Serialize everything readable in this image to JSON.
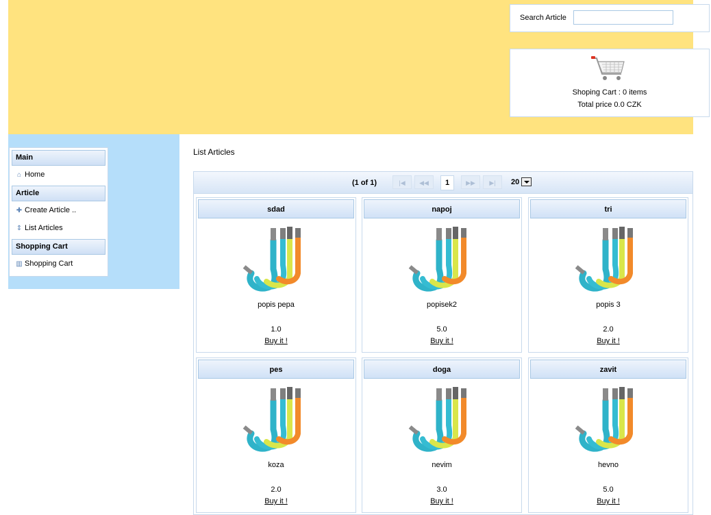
{
  "search": {
    "label": "Search Article",
    "value": ""
  },
  "cart": {
    "items_text": "Shoping Cart : 0 items",
    "price_text": "Total price 0.0 CZK"
  },
  "menu": {
    "main_header": "Main",
    "home": "Home",
    "article_header": "Article",
    "create_article": "Create Article ..",
    "list_articles": "List Articles",
    "cart_header": "Shopping Cart",
    "shopping_cart": "Shopping Cart"
  },
  "page_title": "List Articles",
  "paginator": {
    "count": "(1 of 1)",
    "current_page": "1",
    "rows_per_page": "20"
  },
  "articles": [
    {
      "name": "sdad",
      "description": "popis pepa",
      "price": "1.0",
      "buy": "Buy it !"
    },
    {
      "name": "napoj",
      "description": "popisek2",
      "price": "5.0",
      "buy": "Buy it !"
    },
    {
      "name": "tri",
      "description": "popis 3",
      "price": "2.0",
      "buy": "Buy it !"
    },
    {
      "name": "pes",
      "description": "koza",
      "price": "2.0",
      "buy": "Buy it !"
    },
    {
      "name": "doga",
      "description": "nevim",
      "price": "3.0",
      "buy": "Buy it !"
    },
    {
      "name": "zavit",
      "description": "hevno",
      "price": "5.0",
      "buy": "Buy it !"
    }
  ]
}
